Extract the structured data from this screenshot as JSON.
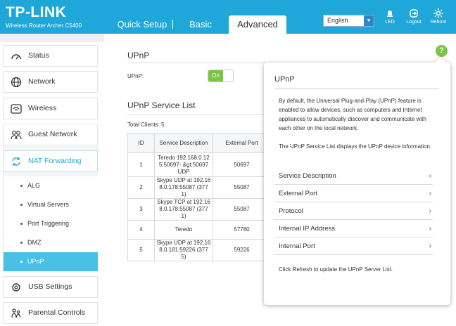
{
  "header": {
    "logo": "TP-LINK",
    "model": "Wireless Router Archer C5400",
    "tabs": [
      "Quick Setup",
      "Basic",
      "Advanced"
    ],
    "language": "English",
    "buttons": {
      "led": "LED",
      "logout": "Logout",
      "reboot": "Reboot"
    }
  },
  "sidebar": {
    "items": [
      "Status",
      "Network",
      "Wireless",
      "Guest Network",
      "NAT Forwarding",
      "USB Settings",
      "Parental Controls"
    ],
    "sub_items": [
      "ALG",
      "Virtual Servers",
      "Port Triggering",
      "DMZ",
      "UPnP"
    ]
  },
  "main": {
    "upnp_title": "UPnP",
    "upnp_label": "UPnP:",
    "toggle_label": "On",
    "service_list_title": "UPnP Service List",
    "total_clients": "Total Clients: 5",
    "table": {
      "headers": [
        "ID",
        "Service Description",
        "External Port"
      ],
      "rows": [
        {
          "id": "1",
          "desc": "Teredo 192.168.0.12 5:50697- &gt;50697 UDP",
          "port": "50697"
        },
        {
          "id": "2",
          "desc": "Skype UDP at 192.16 8.0.178:55087 (377 1)",
          "port": "55087"
        },
        {
          "id": "3",
          "desc": "Skype TCP at 192.16 8.0.178:55087 (377 1)",
          "port": "55087"
        },
        {
          "id": "4",
          "desc": "Teredo",
          "port": "57780"
        },
        {
          "id": "5",
          "desc": "Skype UDP at 192.16 8.0.181:59226 (377 5)",
          "port": "59226"
        }
      ]
    }
  },
  "help": {
    "icon": "?",
    "title": "UPnP",
    "p1": "By default, the Universal Plug-and-Play (UPnP) feature is enabled to allow devices, such as computers and Internet appliances to automatically discover and communicate with each other on the local network.",
    "p2": "The UPnP Service List displays the UPnP device information.",
    "items": [
      "Service Description",
      "External Port",
      "Protocol",
      "Internal IP Address",
      "Internal Port"
    ],
    "chevron": "›",
    "p3": "Click Refresh to update the UPnP Server List."
  },
  "colors": {
    "brand": "#1ea7d8",
    "active_sub": "#49c1e6",
    "toggle_on": "#7bc544"
  }
}
